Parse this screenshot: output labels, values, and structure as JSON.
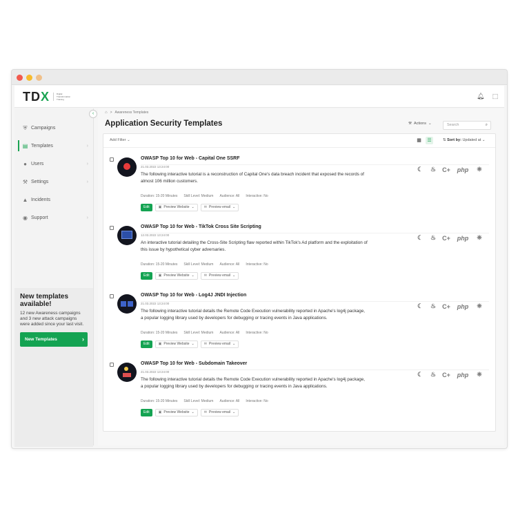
{
  "app": {
    "logo": "TDX",
    "logo_subtitle": "Digital Transformation Training"
  },
  "header_icons": [
    "bell-icon",
    "user-scan-icon"
  ],
  "sidebar": {
    "items": [
      {
        "label": "Campaigns",
        "icon": "shield-icon",
        "active": false
      },
      {
        "label": "Templates",
        "icon": "template-icon",
        "active": true
      },
      {
        "label": "Users",
        "icon": "user-icon",
        "active": false
      },
      {
        "label": "Settings",
        "icon": "wrench-icon",
        "active": false
      },
      {
        "label": "Incidents",
        "icon": "incident-icon",
        "active": false
      },
      {
        "label": "Support",
        "icon": "chat-icon",
        "active": false
      }
    ],
    "promo": {
      "title": "New templates available!",
      "text": "12 new Awareness campaigns and 3 new attack campaigns were added since your last visit.",
      "button": "New Templates"
    }
  },
  "breadcrumb": {
    "page": "Awareness Templates"
  },
  "page_title": "Application Security Templates",
  "toolbar": {
    "actions": "Actions",
    "search_placeholder": "Search",
    "add_filter": "Add Filter",
    "sort_label": "Sort by:",
    "sort_value": "Updated at"
  },
  "templates": [
    {
      "title": "OWASP Top 10 for Web - Capital One SSRF",
      "date": "21.03.2022 13:24:00",
      "description": "The following interactive tutorial is a reconstruction of Capital One's data breach incident that exposed the records of almost 106 million customers.",
      "duration": "Duration: 15-20 Minutes",
      "skill": "Skill Level: Medium",
      "audience": "Audience: All",
      "interactive": "Interactive: No"
    },
    {
      "title": "OWASP Top 10 for Web - TikTok Cross Site Scripting",
      "date": "12.03.2022 13:24:00",
      "description": "An interactive tutorial detailing the Cross-Site Scripting flaw reported within TikTok's Ad platform and the exploitation of this issue by hypothetical cyber adversaries.",
      "duration": "Duration: 15-20 Minutes",
      "skill": "Skill Level: Medium",
      "audience": "Audience: All",
      "interactive": "Interactive: No"
    },
    {
      "title": "OWASP Top 10 for Web - Log4J JNDI Injection",
      "date": "21.03.2022 13:24:00",
      "description": "The following interactive tutorial details the Remote Code Execution vulnerability reported in Apache's log4j package, a popular logging library used by developers for debugging or tracing events in Java applications.",
      "duration": "Duration: 15-20 Minutes",
      "skill": "Skill Level: Medium",
      "audience": "Audience: All",
      "interactive": "Interactive: No"
    },
    {
      "title": "OWASP Top 10 for Web - Subdomain Takeover",
      "date": "21.03.2022 13:24:00",
      "description": "The following interactive tutorial details the Remote Code Execution vulnerability reported in Apache's log4j package, a popular logging library used by developers for debugging or tracing events in Java applications.",
      "duration": "Duration: 15-20 Minutes",
      "skill": "Skill Level: Medium",
      "audience": "Audience: All",
      "interactive": "Interactive: No"
    }
  ],
  "row_buttons": {
    "edit": "Edit",
    "preview_website": "Preview Website",
    "preview_email": "Preview email"
  },
  "languages": [
    "C",
    "Java",
    "C++",
    "php",
    "Python"
  ],
  "colors": {
    "accent": "#14a352",
    "window_red": "#f25a4e",
    "window_yellow": "#f7bb2e",
    "window_orange": "#f0c08a"
  }
}
